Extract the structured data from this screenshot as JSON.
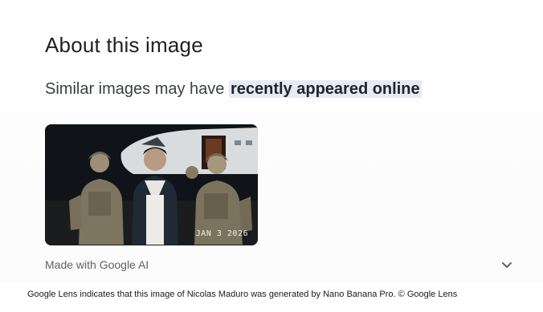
{
  "title": "About this image",
  "subtitle": {
    "prefix": "Similar images may have ",
    "highlight": "recently appeared online"
  },
  "image": {
    "date_stamp": "JAN 3 2026"
  },
  "badge": {
    "label": "Made with Google AI"
  },
  "caption": "Google Lens indicates that this image of Nicolas Maduro was generated by Nano Banana Pro. © Google Lens",
  "icons": {
    "expand": "chevron-down-icon"
  }
}
